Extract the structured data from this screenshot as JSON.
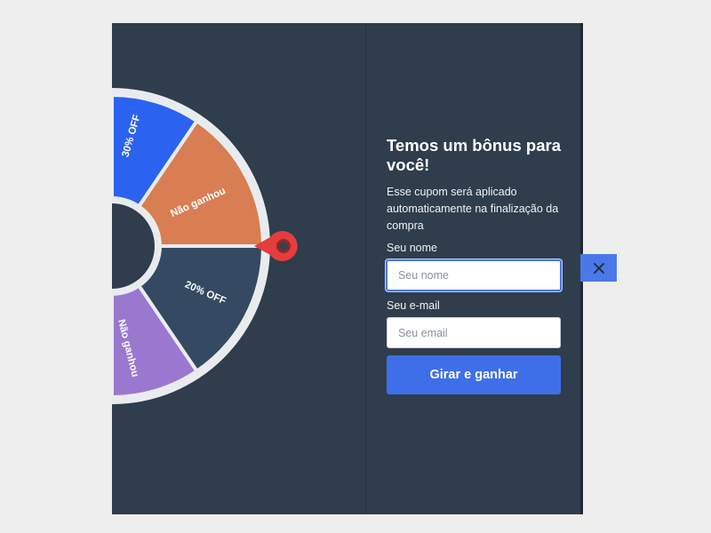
{
  "wheel": {
    "segments": [
      {
        "label": "30% OFF",
        "color": "#2b62f0"
      },
      {
        "label": "Não ganhou",
        "color": "#d97e52"
      },
      {
        "label": "20% OFF",
        "color": "#354a62"
      },
      {
        "label": "Não ganhou",
        "color": "#9b78cf"
      }
    ],
    "rim_color": "#e9ecef",
    "pointer_color": "#e53c3c"
  },
  "form": {
    "title": "Temos um bônus para você!",
    "subtitle": "Esse cupom será aplicado automaticamente na finalização da compra",
    "name_label": "Seu nome",
    "name_placeholder": "Seu nome",
    "name_value": "",
    "email_label": "Seu e-mail",
    "email_placeholder": "Seu email",
    "email_value": "",
    "submit_label": "Girar e ganhar"
  },
  "close": {
    "icon": "close-icon"
  }
}
